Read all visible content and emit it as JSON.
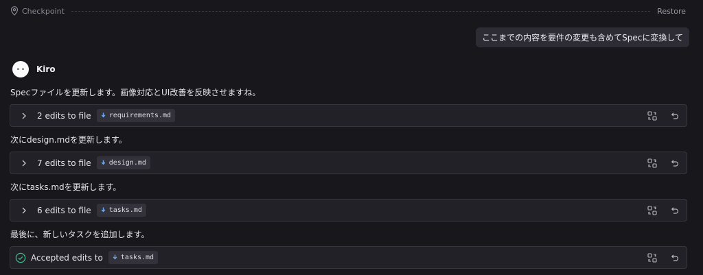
{
  "checkpoint": {
    "label": "Checkpoint",
    "restore_label": "Restore"
  },
  "user_message": "ここまでの内容を要件の変更も含めてSpecに変換して",
  "agent": {
    "name": "Kiro"
  },
  "messages": [
    "Specファイルを更新します。画像対応とUI改善を反映させますね。",
    "次にdesign.mdを更新します。",
    "次にtasks.mdを更新します。",
    "最後に、新しいタスクを追加します。"
  ],
  "edit_cards": [
    {
      "label": "2 edits to file",
      "file": "requirements.md"
    },
    {
      "label": "7 edits to file",
      "file": "design.md"
    },
    {
      "label": "6 edits to file",
      "file": "tasks.md"
    },
    {
      "label": "Accepted edits to",
      "file": "tasks.md"
    }
  ],
  "icons": {
    "checkpoint": "map-pin-icon",
    "chevron": "chevron-right-icon",
    "compare": "compare-diff-icon",
    "revert": "undo-icon",
    "accepted": "check-circle-icon",
    "file": "markdown-file-icon"
  },
  "colors": {
    "accepted": "#3fb68b",
    "file_icon": "#6ea8f0"
  }
}
